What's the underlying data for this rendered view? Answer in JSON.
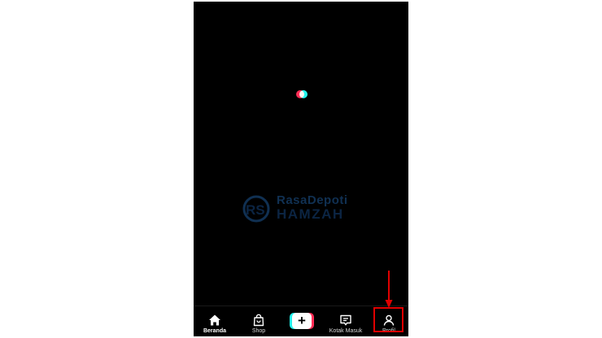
{
  "app": {
    "name": "TikTok"
  },
  "watermark": {
    "line1": "RasaDepoti",
    "line2": "HAMZAH"
  },
  "navbar": {
    "items": [
      {
        "label": "Beranda",
        "icon": "home-icon",
        "active": true
      },
      {
        "label": "Shop",
        "icon": "shopping-bag-icon",
        "active": false
      },
      {
        "label": "+",
        "icon": "create-plus-icon",
        "active": false
      },
      {
        "label": "Kotak Masuk",
        "icon": "inbox-icon",
        "active": false
      },
      {
        "label": "Profil",
        "icon": "profile-icon",
        "active": false
      }
    ]
  },
  "colors": {
    "background": "#000000",
    "tiktok_red": "#fe2c55",
    "tiktok_cyan": "#25f4ee",
    "annotation_red": "#e00000"
  }
}
